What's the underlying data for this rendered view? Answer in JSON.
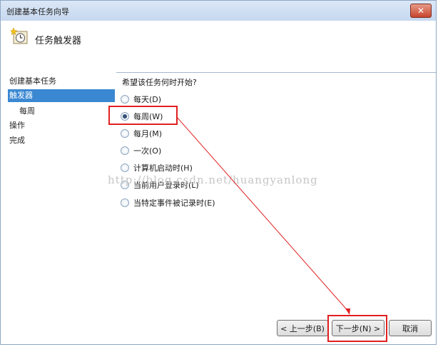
{
  "window": {
    "title": "创建基本任务向导",
    "close_label": "✕"
  },
  "header": {
    "title": "任务触发器",
    "icon": "clock-calendar-icon"
  },
  "nav": {
    "items": [
      {
        "label": "创建基本任务"
      },
      {
        "label": "触发器"
      },
      {
        "label": "每周"
      },
      {
        "label": "操作"
      },
      {
        "label": "完成"
      }
    ]
  },
  "content": {
    "question": "希望该任务何时开始?",
    "options": [
      {
        "label": "每天(D)",
        "checked": false
      },
      {
        "label": "每周(W)",
        "checked": true
      },
      {
        "label": "每月(M)",
        "checked": false
      },
      {
        "label": "一次(O)",
        "checked": false
      },
      {
        "label": "计算机启动时(H)",
        "checked": false
      },
      {
        "label": "当前用户登录时(L)",
        "checked": false
      },
      {
        "label": "当特定事件被记录时(E)",
        "checked": false
      }
    ]
  },
  "buttons": {
    "back": "< 上一步(B)",
    "next": "下一步(N) >",
    "cancel": "取消"
  },
  "watermark": "http://blog.csdn.net/huangyanlong",
  "colors": {
    "selection": "#3b88d2",
    "annotation": "#e02020"
  }
}
